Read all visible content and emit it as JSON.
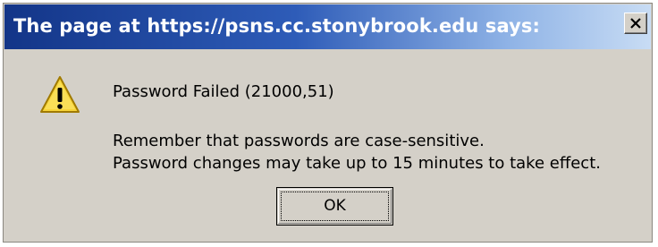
{
  "dialog": {
    "title": "The page at https://psns.cc.stonybrook.edu says:",
    "close_glyph": "X",
    "icon": "warning-icon",
    "message": "Password Failed (21000,51)",
    "details": [
      "Remember that passwords are case-sensitive.",
      "Password changes may take up to 15 minutes to take effect."
    ],
    "ok_label": "OK"
  },
  "colors": {
    "titlebar_start": "#133588",
    "titlebar_end": "#c8dcf4",
    "dialog_background": "#d4d0c8",
    "warning_fill": "#f7d43a",
    "warning_outline": "#a07a00"
  }
}
